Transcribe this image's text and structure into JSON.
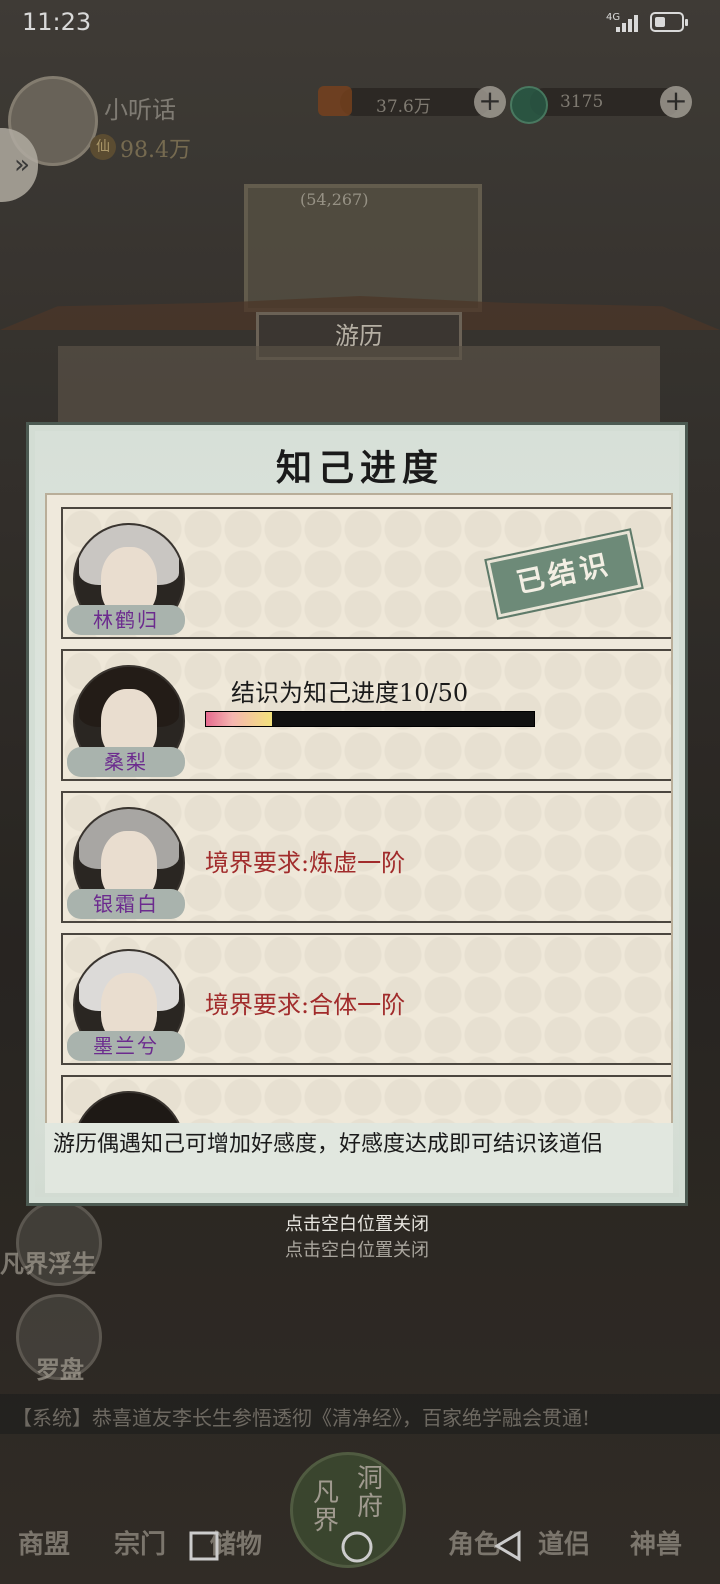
{
  "status_bar": {
    "time": "11:23",
    "network": "4G"
  },
  "player": {
    "name": "小听话",
    "power": "98.4万"
  },
  "resources": {
    "gold": "37.6万",
    "jade": "3175",
    "plus": "+"
  },
  "map": {
    "count": "(54,267)"
  },
  "location_sign": "游历",
  "dialog": {
    "title": "知己进度",
    "characters": [
      {
        "name": "林鹤归",
        "status": "已结识"
      },
      {
        "name": "桑梨",
        "progress_label": "结识为知己进度10/50",
        "progress": 0.2
      },
      {
        "name": "银霜白",
        "requirement": "境界要求:炼虚一阶"
      },
      {
        "name": "墨兰兮",
        "requirement": "境界要求:合体一阶"
      }
    ],
    "tip": "游历偶遇知己可增加好感度，好感度达成即可结识该道侣",
    "close_hint": "点击空白位置关闭",
    "close_hint_shadow": "点击空白位置关闭"
  },
  "side_buttons": {
    "left1": "凡界浮生",
    "left2": "罗盘"
  },
  "announcement": "【系统】恭喜道友李长生参悟透彻《清净经》，百家绝学融会贯通!",
  "nav": {
    "items": [
      "商盟",
      "宗门",
      "储物",
      "角色",
      "道侣",
      "神兽"
    ],
    "center": "凡界",
    "center2": "洞府"
  },
  "colors": {
    "req_red": "#a12b2b",
    "name_purple": "#6c2b8e",
    "stamp_green": "#6d8a78"
  }
}
